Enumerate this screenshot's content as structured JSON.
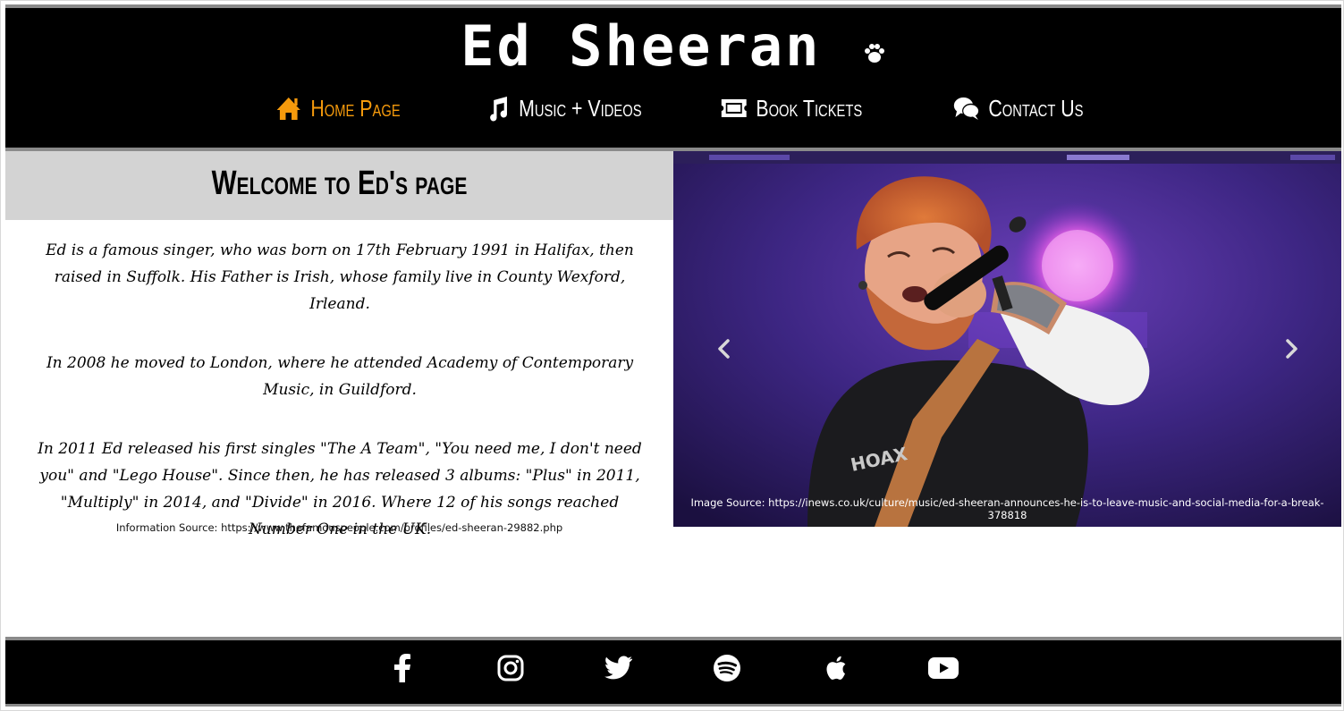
{
  "header": {
    "logo_text": "Ed Sheeran",
    "nav": [
      {
        "label": "Home Page",
        "icon": "home-icon",
        "active": true
      },
      {
        "label": "Music + Videos",
        "icon": "music-icon",
        "active": false
      },
      {
        "label": "Book Tickets",
        "icon": "ticket-icon",
        "active": false
      },
      {
        "label": "Contact Us",
        "icon": "comments-icon",
        "active": false
      }
    ]
  },
  "main": {
    "welcome_title": "Welcome to Ed's page",
    "bio": [
      "Ed is a famous singer, who was born on 17th February 1991 in Halifax, then raised in Suffolk. His Father is Irish, whose family live in County Wexford, Irleand.",
      "In 2008 he moved to London, where he attended Academy of Contemporary Music, in Guildford.",
      "In 2011 Ed released his first singles \"The A Team\", \"You need me, I don't need you\" and \"Lego House\". Since then, he has released 3 albums: \"Plus\" in 2011, \"Multiply\" in 2014, and \"Divide\" in 2016. Where 12 of his songs reached Number One in the UK."
    ],
    "info_source": "Information Source: https://www.thefamouspeople.com/profiles/ed-sheeran-29882.php",
    "carousel": {
      "image_source": "Image Source: https://inews.co.uk/culture/music/ed-sheeran-announces-he-is-to-leave-music-and-social-media-for-a-break-378818",
      "shirt_text": "HOAX"
    }
  },
  "footer": {
    "social": [
      "facebook-icon",
      "instagram-icon",
      "twitter-icon",
      "spotify-icon",
      "apple-icon",
      "youtube-icon"
    ]
  },
  "colors": {
    "accent": "#f59a0c",
    "header_bg": "#000000",
    "band_bg": "#d3d3d3",
    "border_gray": "#8a8a8a"
  }
}
